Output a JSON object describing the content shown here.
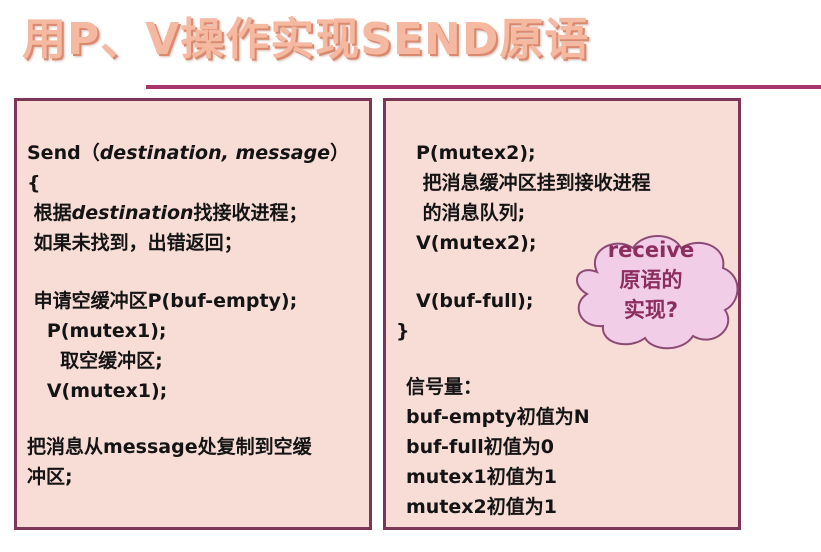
{
  "title": "用P、V操作实现SEND原语",
  "left_panel": {
    "l1a": "Send（",
    "l1b": "destination, message",
    "l1c": "）",
    "l2": "{",
    "l3a": " 根据",
    "l3b": "destination",
    "l3c": "找接收进程；",
    "l4": " 如果未找到，出错返回；",
    "l5": " 申请空缓冲区P(buf-empty);",
    "l6": "   P(mutex1);",
    "l7": "     取空缓冲区;",
    "l8": "   V(mutex1);",
    "l9": "把消息从message处复制到空缓",
    "l10": "冲区;"
  },
  "right_panel": {
    "r1": "P(mutex2);",
    "r2": " 把消息缓冲区挂到接收进程",
    "r3": " 的消息队列;",
    "r4": "V(mutex2);",
    "r5": "V(buf-full);",
    "r6": "}",
    "r7": "信号量：",
    "r8": "buf-empty初值为N",
    "r9": "buf-full初值为0",
    "r10": "mutex1初值为1",
    "r11": "mutex2初值为1"
  },
  "cloud": {
    "line1": "receive",
    "line2": "原语的",
    "line3": "实现?"
  },
  "colors": {
    "title": "#f5b8a0",
    "rule": "#a8356d",
    "panel_bg": "#f7ddd5",
    "panel_border": "#7d3658",
    "cloud_fill": "#f2cde8",
    "cloud_stroke": "#8b4a74",
    "cloud_text": "#8b2d5f"
  }
}
